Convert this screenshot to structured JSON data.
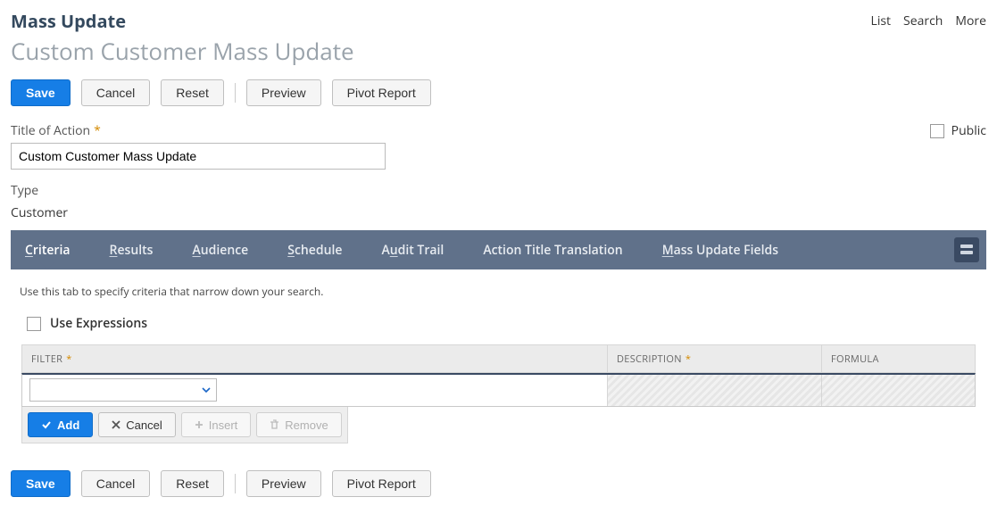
{
  "header": {
    "title": "Mass Update",
    "subtitle": "Custom Customer Mass Update",
    "links": {
      "list": "List",
      "search": "Search",
      "more": "More"
    }
  },
  "toolbar": {
    "save": "Save",
    "cancel": "Cancel",
    "reset": "Reset",
    "preview": "Preview",
    "pivot": "Pivot Report"
  },
  "form": {
    "title_label": "Title of Action",
    "title_value": "Custom Customer Mass Update",
    "public_label": "Public",
    "type_label": "Type",
    "type_value": "Customer"
  },
  "tabs": {
    "criteria": "Criteria",
    "results": "Results",
    "audience": "Audience",
    "schedule": "Schedule",
    "audit": "Audit Trail",
    "action_title_translation": "Action Title Translation",
    "mass_update_fields": "Mass Update Fields",
    "accel": {
      "criteria": "C",
      "results": "R",
      "audience": "A",
      "schedule": "S",
      "audit": "u",
      "mass": "M"
    }
  },
  "criteria": {
    "hint": "Use this tab to specify criteria that narrow down your search.",
    "use_expressions_label": "Use Expressions",
    "columns": {
      "filter": "FILTER",
      "description": "DESCRIPTION",
      "formula": "FORMULA"
    },
    "row_actions": {
      "add": "Add",
      "cancel": "Cancel",
      "insert": "Insert",
      "remove": "Remove"
    }
  }
}
